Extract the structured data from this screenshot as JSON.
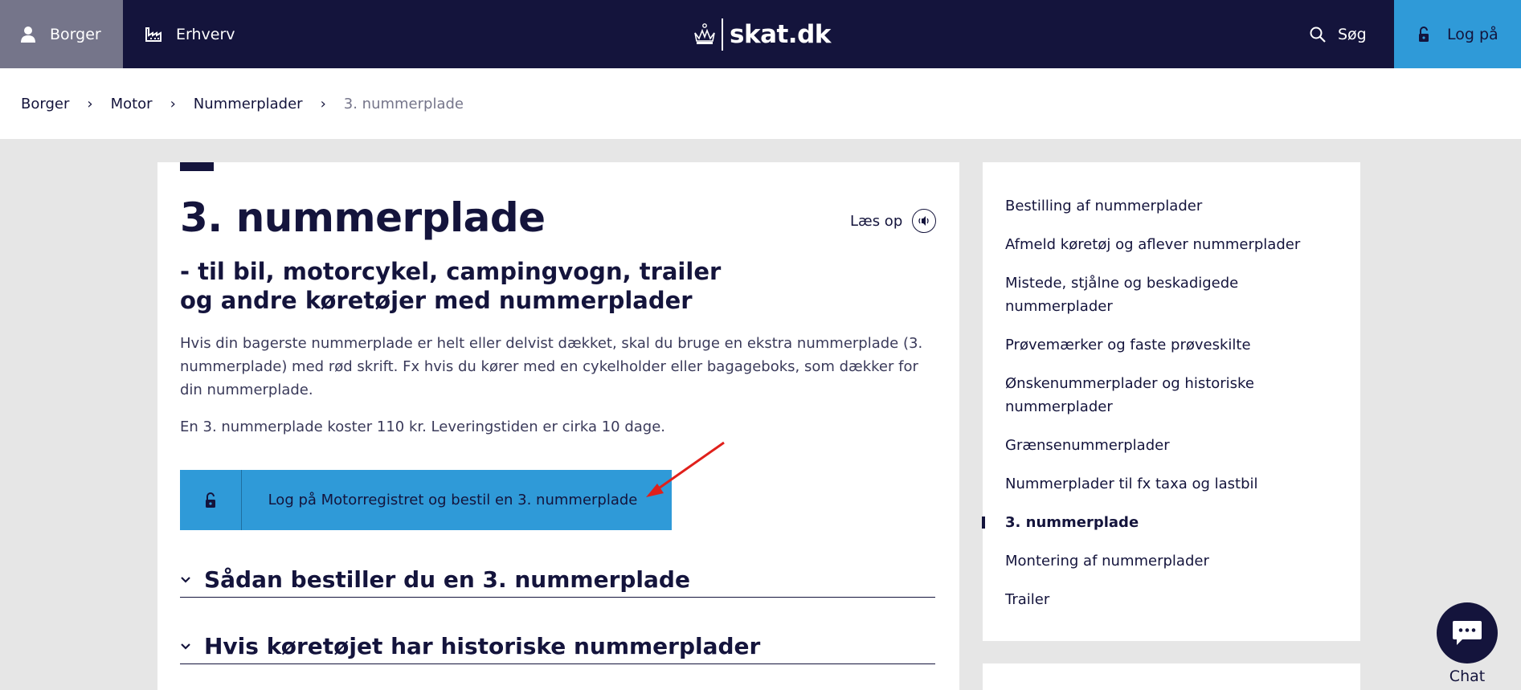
{
  "header": {
    "tab_borger": "Borger",
    "tab_erhverv": "Erhverv",
    "logo_text": "skat.dk",
    "search_label": "Søg",
    "login_label": "Log på"
  },
  "breadcrumb": {
    "items": [
      "Borger",
      "Motor",
      "Nummerplader"
    ],
    "current": "3. nummerplade"
  },
  "main": {
    "title": "3. nummerplade",
    "read_aloud": "Læs op",
    "subtitle": "- til bil, motorcykel, campingvogn, trailer og andre køretøjer med nummerplader",
    "intro": "Hvis din bagerste nummerplade er helt eller delvist dækket, skal du bruge en ekstra nummerplade (3. nummerplade) med rød skrift. Fx hvis du kører med en cykelholder eller bagageboks, som dækker for din nummerplade.",
    "price": "En 3. nummerplade koster 110 kr. Leveringstiden er cirka 10 dage.",
    "cta_label": "Log på Motorregistret og bestil en 3. nummerplade",
    "accordions": [
      "Sådan bestiller du en 3. nummerplade",
      "Hvis køretøjet har historiske nummerplader"
    ]
  },
  "sidenav": {
    "items": [
      "Bestilling af nummerplader",
      "Afmeld køretøj og aflever nummerplader",
      "Mistede, stjålne og beskadigede nummerplader",
      "Prøvemærker og faste prøveskilte",
      "Ønskenummerplader og historiske nummerplader",
      "Grænsenummerplader",
      "Nummerplader til fx taxa og lastbil",
      "3. nummerplade",
      "Montering af nummerplader",
      "Trailer"
    ],
    "active_index": 7
  },
  "chat": {
    "label": "Chat"
  },
  "colors": {
    "navy": "#14143c",
    "accent_blue": "#2f9ad8",
    "tab_active_grey": "#75758a",
    "background_grey": "#e6e6e6",
    "annotation_arrow": "#e0201b"
  }
}
